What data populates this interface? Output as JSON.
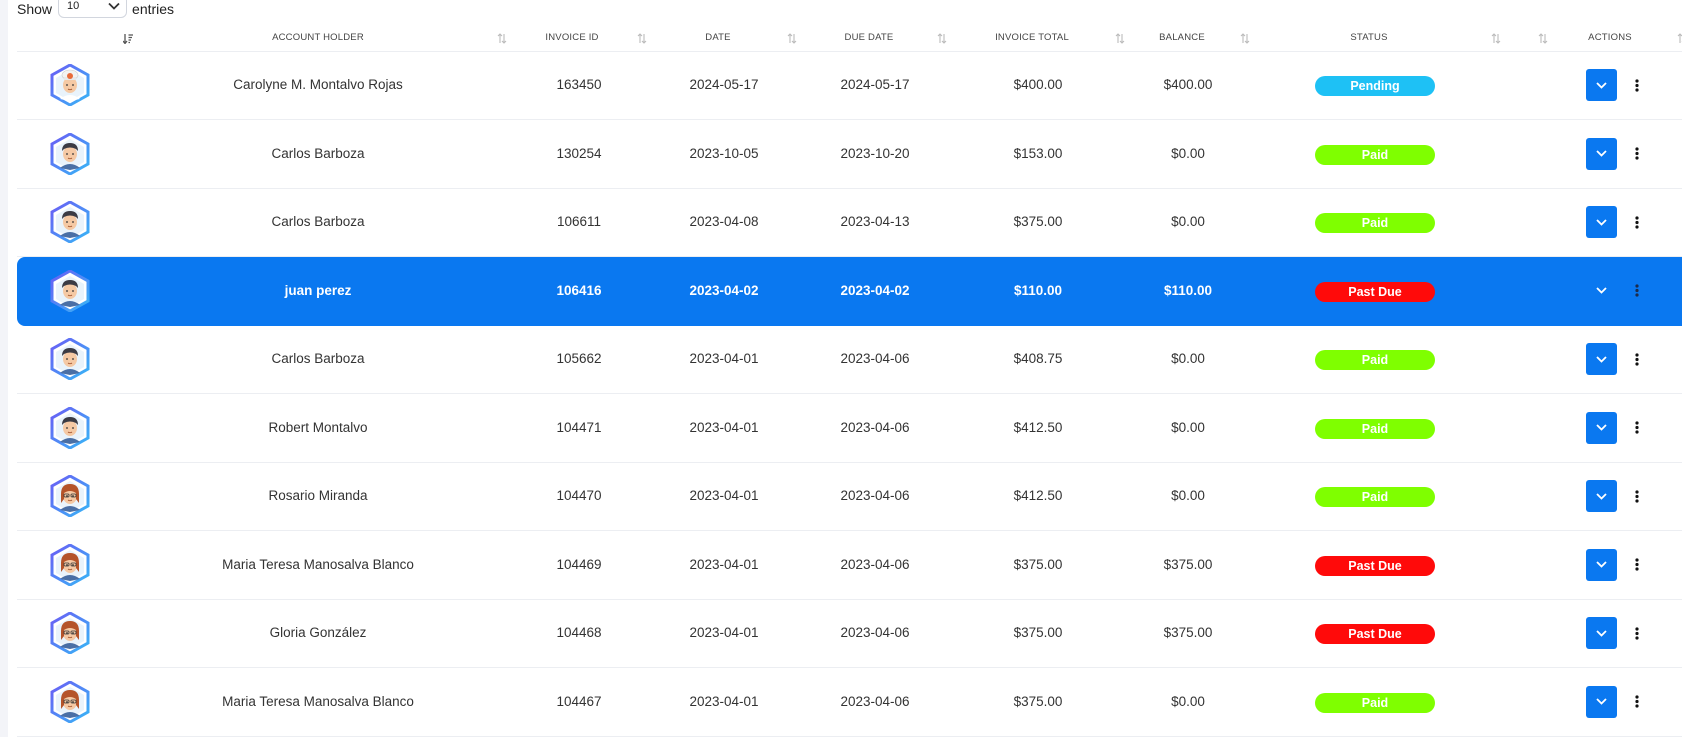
{
  "length_menu": {
    "prefix": "Show",
    "value": "10",
    "suffix": "entries"
  },
  "columns": [
    "ACCOUNT HOLDER",
    "INVOICE ID",
    "DATE",
    "DUE DATE",
    "INVOICE TOTAL",
    "BALANCE",
    "STATUS",
    "ACTIONS"
  ],
  "status_colors": {
    "Pending": "#1ec1f5",
    "Paid": "#7fff00",
    "Past Due": "#ff0a0a"
  },
  "accent_color": "#0a78f0",
  "rows": [
    {
      "account_holder": "Carolyne M. Montalvo Rojas",
      "invoice_id": "163450",
      "date": "2024-05-17",
      "due_date": "2024-05-17",
      "invoice_total": "$400.00",
      "balance": "$400.00",
      "status": "Pending",
      "avatar": "chef-avatar-icon",
      "selected": false
    },
    {
      "account_holder": "Carlos Barboza",
      "invoice_id": "130254",
      "date": "2023-10-05",
      "due_date": "2023-10-20",
      "invoice_total": "$153.00",
      "balance": "$0.00",
      "status": "Paid",
      "avatar": "man-avatar-icon",
      "selected": false
    },
    {
      "account_holder": "Carlos Barboza",
      "invoice_id": "106611",
      "date": "2023-04-08",
      "due_date": "2023-04-13",
      "invoice_total": "$375.00",
      "balance": "$0.00",
      "status": "Paid",
      "avatar": "man-avatar-icon",
      "selected": false
    },
    {
      "account_holder": "juan perez",
      "invoice_id": "106416",
      "date": "2023-04-02",
      "due_date": "2023-04-02",
      "invoice_total": "$110.00",
      "balance": "$110.00",
      "status": "Past Due",
      "avatar": "man-avatar-icon",
      "selected": true
    },
    {
      "account_holder": "Carlos Barboza",
      "invoice_id": "105662",
      "date": "2023-04-01",
      "due_date": "2023-04-06",
      "invoice_total": "$408.75",
      "balance": "$0.00",
      "status": "Paid",
      "avatar": "man-avatar-icon",
      "selected": false
    },
    {
      "account_holder": "Robert Montalvo",
      "invoice_id": "104471",
      "date": "2023-04-01",
      "due_date": "2023-04-06",
      "invoice_total": "$412.50",
      "balance": "$0.00",
      "status": "Paid",
      "avatar": "man-avatar-icon",
      "selected": false
    },
    {
      "account_holder": "Rosario Miranda",
      "invoice_id": "104470",
      "date": "2023-04-01",
      "due_date": "2023-04-06",
      "invoice_total": "$412.50",
      "balance": "$0.00",
      "status": "Paid",
      "avatar": "woman-avatar-icon",
      "selected": false
    },
    {
      "account_holder": "Maria Teresa Manosalva Blanco",
      "invoice_id": "104469",
      "date": "2023-04-01",
      "due_date": "2023-04-06",
      "invoice_total": "$375.00",
      "balance": "$375.00",
      "status": "Past Due",
      "avatar": "woman-avatar-icon",
      "selected": false
    },
    {
      "account_holder": "Gloria González",
      "invoice_id": "104468",
      "date": "2023-04-01",
      "due_date": "2023-04-06",
      "invoice_total": "$375.00",
      "balance": "$375.00",
      "status": "Past Due",
      "avatar": "woman-avatar-icon",
      "selected": false
    },
    {
      "account_holder": "Maria Teresa Manosalva Blanco",
      "invoice_id": "104467",
      "date": "2023-04-01",
      "due_date": "2023-04-06",
      "invoice_total": "$375.00",
      "balance": "$0.00",
      "status": "Paid",
      "avatar": "woman-avatar-icon",
      "selected": false
    }
  ]
}
